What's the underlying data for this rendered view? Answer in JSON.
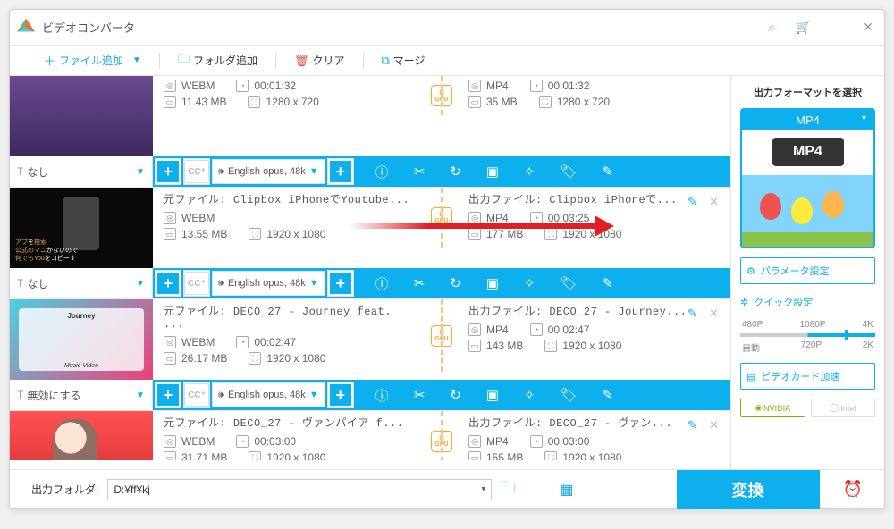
{
  "app": {
    "title": "ビデオコンバータ"
  },
  "toolbar": {
    "add_file": "ファイル追加",
    "add_folder": "フォルダ追加",
    "clear": "クリア",
    "merge": "マージ"
  },
  "rows": [
    {
      "src_format": "WEBM",
      "src_dur": "00:01:32",
      "src_size": "11.43 MB",
      "src_res": "1280 x 720",
      "dst_format": "MP4",
      "dst_dur": "00:01:32",
      "dst_size": "35 MB",
      "dst_res": "1280 x 720",
      "subtitle": "なし",
      "audio": "English opus, 48k"
    },
    {
      "src_title": "元ファイル:  Clipbox  iPhoneでYoutube...",
      "dst_title": "出力ファイル:  Clipbox  iPhoneで...",
      "src_format": "WEBM",
      "src_dur": "",
      "src_size": "13.55 MB",
      "src_res": "1920 x 1080",
      "dst_format": "MP4",
      "dst_dur": "00:03:25",
      "dst_size": "177 MB",
      "dst_res": "1920 x 1080",
      "subtitle": "なし",
      "audio": "English opus, 48k"
    },
    {
      "src_title": "元ファイル:  DECO_27 - Journey feat. ...",
      "dst_title": "出力ファイル:  DECO_27 - Journey...",
      "src_format": "WEBM",
      "src_dur": "00:02:47",
      "src_size": "26.17 MB",
      "src_res": "1920 x 1080",
      "dst_format": "MP4",
      "dst_dur": "00:02:47",
      "dst_size": "143 MB",
      "dst_res": "1920 x 1080",
      "subtitle": "無効にする",
      "audio": "English opus, 48k"
    },
    {
      "src_title": "元ファイル:  DECO_27 - ヴァンパイア f...",
      "dst_title": "出力ファイル:  DECO_27 - ヴァン...",
      "src_format": "WEBM",
      "src_dur": "00:03:00",
      "src_size": "31.71 MB",
      "src_res": "1920 x 1080",
      "dst_format": "MP4",
      "dst_dur": "00:03:00",
      "dst_size": "155 MB",
      "dst_res": "1920 x 1080"
    }
  ],
  "gpu_label": "GPU",
  "sidebar": {
    "head": "出力フォーマットを選択",
    "format": "MP4",
    "badge": "MP4",
    "param": "パラメータ設定",
    "quick": "クイック設定",
    "q480": "480P",
    "q720": "720P",
    "q1080": "1080P",
    "q2k": "2K",
    "q4k": "4K",
    "auto": "自動",
    "gpu_accel": "ビデオカード加速",
    "nvidia": "NVIDIA",
    "intel": "Intel"
  },
  "footer": {
    "label": "出力フォルダ:",
    "path": "D:¥ff¥kj",
    "convert": "変換"
  }
}
